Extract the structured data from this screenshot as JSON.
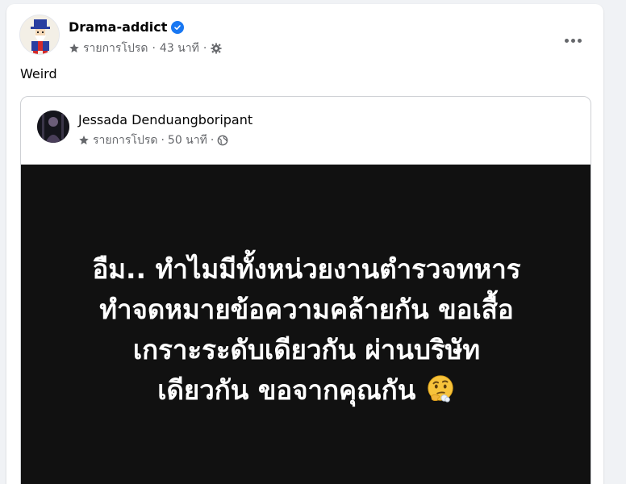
{
  "post": {
    "author": "Drama-addict",
    "audience": "รายการโปรด",
    "time": "43 นาที",
    "text": "Weird"
  },
  "shared": {
    "author": "Jessada Denduangboripant",
    "audience": "รายการโปรด",
    "time": "50 นาที",
    "image_lines": [
      "อืม.. ทำไมมีทั้งหน่วยงานตำรวจทหาร",
      "ทำจดหมายข้อความคล้ายกัน ขอเสื้อ",
      "เกราะระดับเดียวกัน ผ่านบริษัท",
      "เดียวกัน ขอจากคุณกัน"
    ]
  },
  "icons": {
    "verified": "verified-badge-icon",
    "favorites": "star-icon",
    "privacy_post": "gear-icon",
    "privacy_shared": "globe-icon",
    "more": "more-options-icon",
    "emoji": "thinking-face-emoji"
  },
  "colors": {
    "accent": "#1877f2",
    "secondary_text": "#65676b",
    "image_bg": "#111111"
  }
}
